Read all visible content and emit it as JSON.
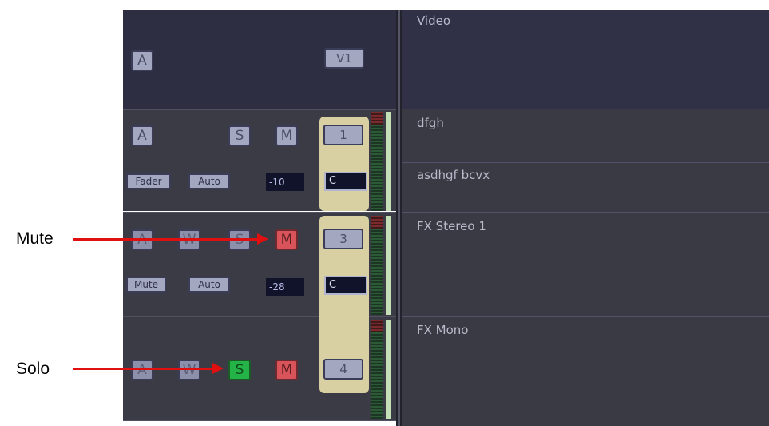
{
  "tracks": {
    "video": {
      "label": "Video",
      "a_label": "A",
      "num_label": "V1"
    },
    "track1": {
      "a_label": "A",
      "s_label": "S",
      "m_label": "M",
      "num_label": "1",
      "fader_label": "Fader",
      "auto_label": "Auto",
      "value": "-10",
      "pan": "C",
      "lane_label_1": "dfgh",
      "lane_label_2": "asdhgf bcvx"
    },
    "track2": {
      "a_label": "A",
      "w_label": "W",
      "s_label": "S",
      "m_label": "M",
      "num_label": "3",
      "mute_label": "Mute",
      "auto_label": "Auto",
      "value": "-28",
      "pan": "C",
      "lane_label": "FX Stereo 1",
      "mute_active": true
    },
    "track3": {
      "a_label": "A",
      "w_label": "W",
      "s_label": "S",
      "m_label": "M",
      "num_label": "4",
      "lane_label": "FX Mono",
      "solo_active": true
    }
  },
  "annotations": {
    "mute": "Mute",
    "solo": "Solo"
  },
  "colors": {
    "mute_active": "#d9545a",
    "solo_active": "#24b347",
    "arrow": "#e01010"
  }
}
